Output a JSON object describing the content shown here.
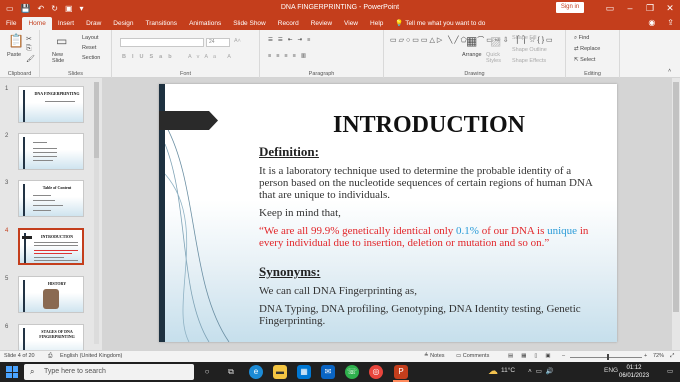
{
  "window": {
    "title": "DNA FINGERPRINTING - PowerPoint",
    "sign_in": "Sign in"
  },
  "tabs": [
    "File",
    "Home",
    "Insert",
    "Draw",
    "Design",
    "Transitions",
    "Animations",
    "Slide Show",
    "Record",
    "Review",
    "View",
    "Help"
  ],
  "active_tab": "Home",
  "tell_me": "Tell me what you want to do",
  "ribbon": {
    "clipboard": {
      "label": "Clipboard",
      "paste": "Paste"
    },
    "slides": {
      "label": "Slides",
      "new_slide": "New Slide",
      "layout": "Layout",
      "reset": "Reset",
      "section": "Section"
    },
    "font": {
      "label": "Font",
      "size": "24"
    },
    "paragraph": {
      "label": "Paragraph"
    },
    "drawing": {
      "label": "Drawing",
      "arrange": "Arrange",
      "quick_styles": "Quick Styles",
      "shape_fill": "Shape Fill",
      "shape_outline": "Shape Outline",
      "shape_effects": "Shape Effects"
    },
    "editing": {
      "label": "Editing",
      "find": "Find",
      "replace": "Replace",
      "select": "Select"
    }
  },
  "thumbnails": [
    {
      "num": "1",
      "title": "DNA FINGERPRINTING"
    },
    {
      "num": "2",
      "title": ""
    },
    {
      "num": "3",
      "title": "Table of Content"
    },
    {
      "num": "4",
      "title": "INTRODUCTION"
    },
    {
      "num": "5",
      "title": "HISTORY"
    },
    {
      "num": "6",
      "title": "STAGES OF DNA FINGERPRINTING"
    }
  ],
  "slide": {
    "title": "INTRODUCTION",
    "definition_heading": "Definition:",
    "definition_text": "It is a laboratory technique used to determine the probable identity of a person based on the nucleotide sequences of certain regions of human DNA that are unique to individuals.",
    "keep_in_mind": "Keep in mind that,",
    "quote_part1": "“We are all 99.9% genetically identical only ",
    "quote_highlight1": "0.1%",
    "quote_part2": " of our DNA is ",
    "quote_highlight2": "unique",
    "quote_part3": " in every individual due to insertion, deletion or mutation and so on.”",
    "synonyms_heading": "Synonyms:",
    "synonyms_intro": "We can call DNA Fingerprinting as,",
    "synonyms_list": "DNA Typing, DNA profiling, Genotyping, DNA Identity testing, Genetic Fingerprinting."
  },
  "status": {
    "slide_of": "Slide 4 of 20",
    "language": "English (United Kingdom)",
    "notes": "Notes",
    "comments": "Comments",
    "zoom": "72%"
  },
  "taskbar": {
    "search_placeholder": "Type here to search",
    "weather": "11°C",
    "lang": "ENG",
    "time": "01:12",
    "date": "06/01/2023"
  },
  "colors": {
    "accent": "#c43e1c",
    "quote_red": "#e2272b",
    "quote_blue": "#2a9bd8"
  }
}
